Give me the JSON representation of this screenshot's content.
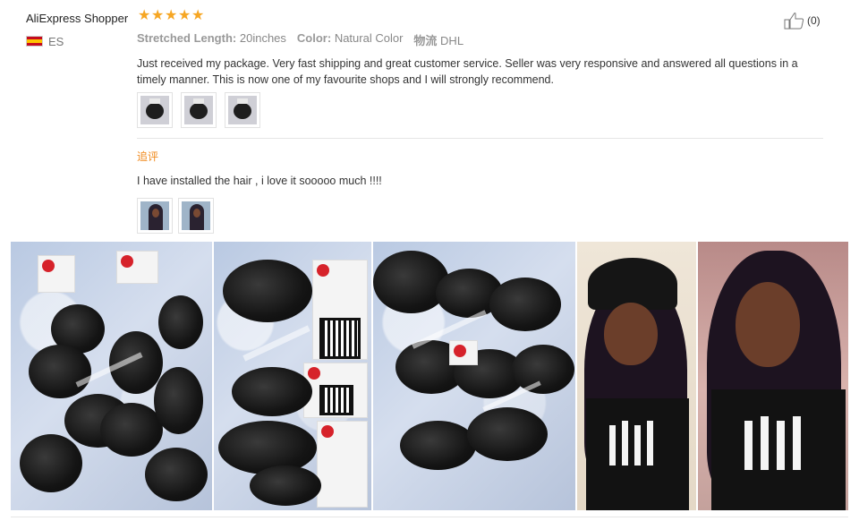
{
  "review": {
    "reviewer_name": "AliExpress Shopper",
    "rating_stars": 5,
    "country_code": "ES",
    "like_count": "(0)",
    "props": {
      "length_label": "Stretched Length:",
      "length_value": "20inches",
      "color_label": "Color:",
      "color_value": "Natural Color",
      "shipping_label": "物流",
      "shipping_value": "DHL"
    },
    "text": "Just received my package. Very fast shipping and great customer service. Seller was very responsive and answered all questions in a timely manner. This is now one of my favourite shops and I will strongly recommend.",
    "followup": {
      "label": "追评",
      "text": "I have installed the hair , i love it sooooo much !!!!"
    }
  },
  "colors": {
    "star": "#f6a623",
    "followup_label": "#f08a1d",
    "text": "#333333",
    "muted": "#999999"
  },
  "icons": {
    "star": "star-icon",
    "like": "thumbs-up-icon",
    "flag": "spain-flag-icon"
  }
}
